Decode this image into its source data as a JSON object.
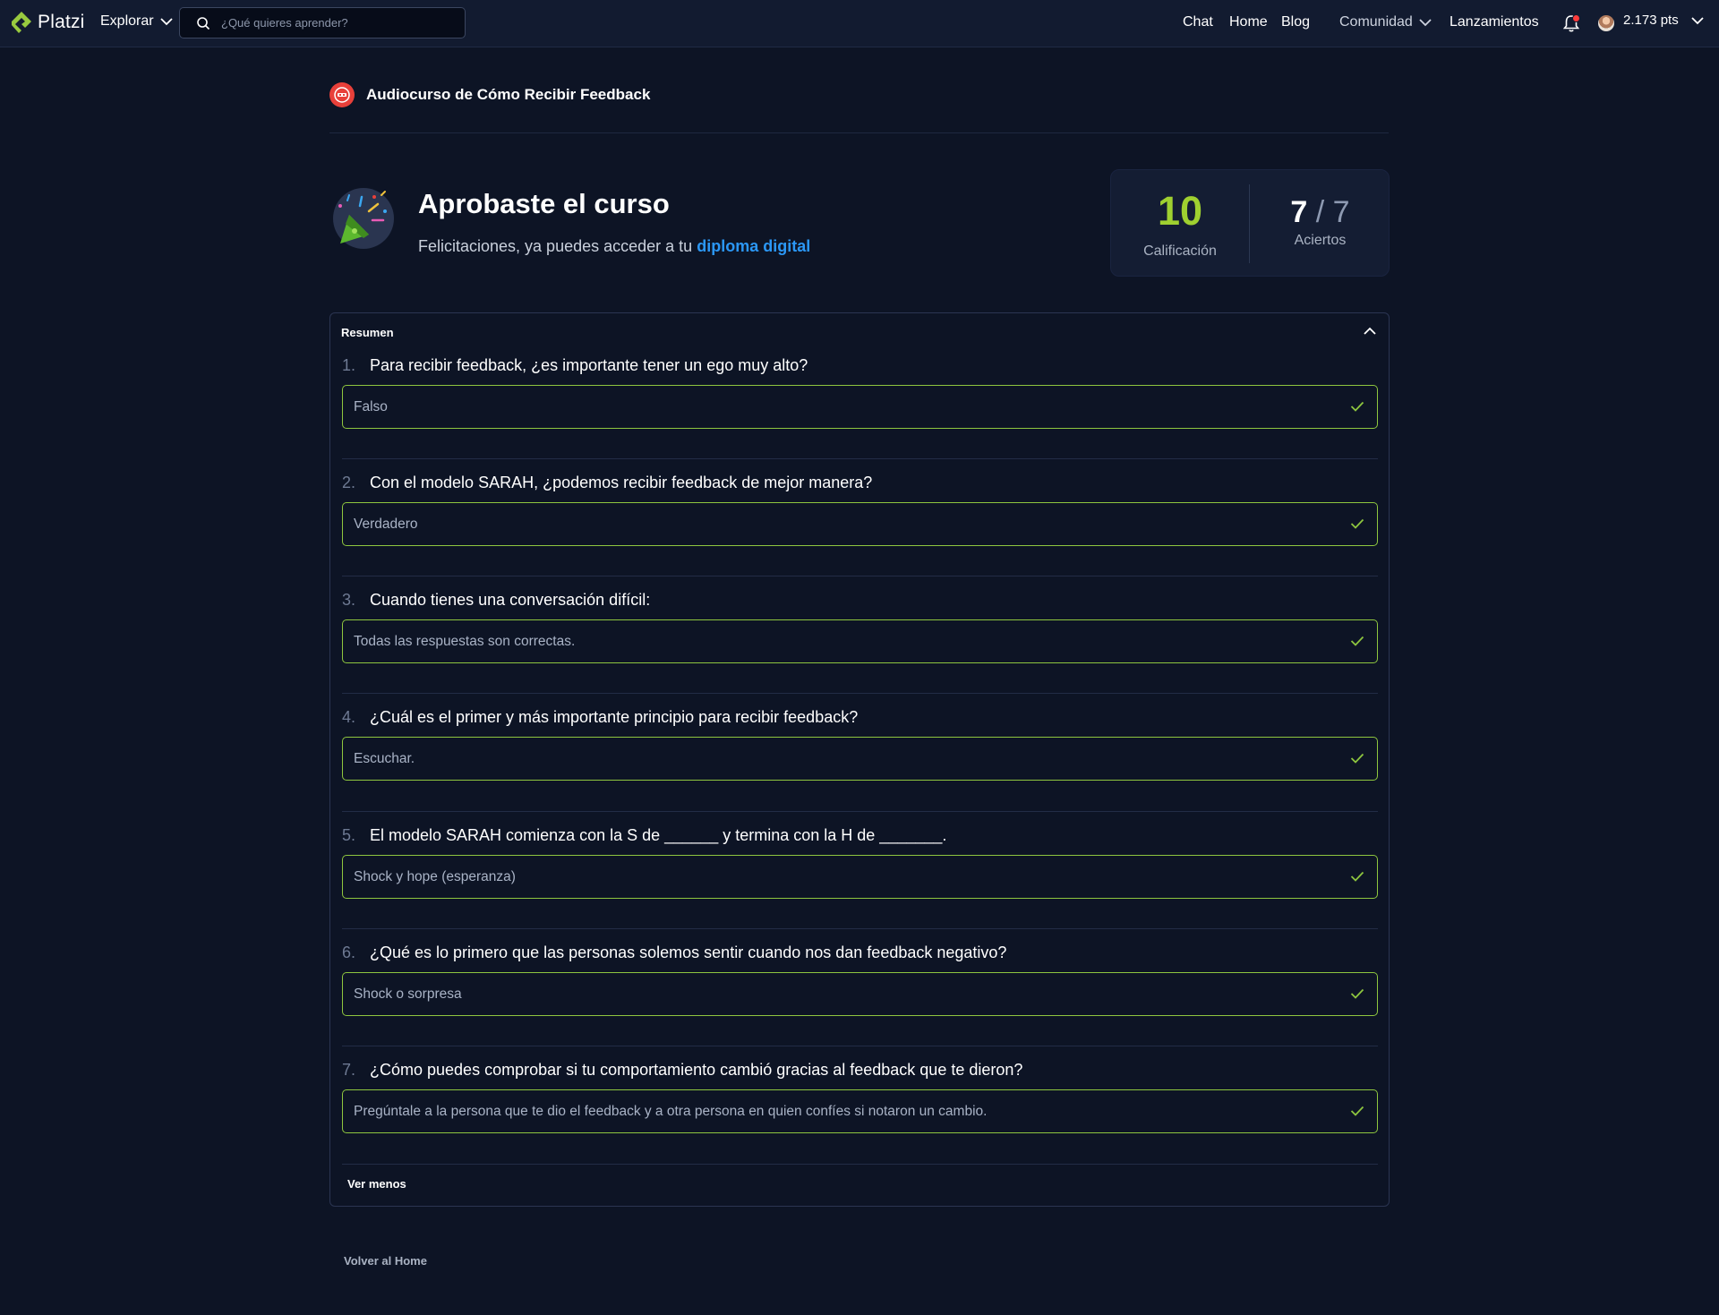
{
  "navbar": {
    "logo_text": "Platzi",
    "explore_label": "Explorar",
    "search_placeholder": "¿Qué quieres aprender?",
    "links": {
      "chat": "Chat",
      "home": "Home",
      "blog": "Blog",
      "community": "Comunidad",
      "launches": "Lanzamientos"
    },
    "points": "2.173 pts"
  },
  "course": {
    "title": "Audiocurso de Cómo Recibir Feedback"
  },
  "result": {
    "title": "Aprobaste el curso",
    "subtitle_prefix": "Felicitaciones, ya puedes acceder a tu",
    "diploma_link": "diploma digital",
    "grade": "10",
    "grade_label": "Calificación",
    "hits": "7",
    "hits_slash": "/",
    "hits_total": "7",
    "hits_label": "Aciertos"
  },
  "summary": {
    "label": "Resumen",
    "see_less": "Ver menos",
    "questions": [
      {
        "number": "1.",
        "text": "Para recibir feedback, ¿es importante tener un ego muy alto?",
        "answer": "Falso"
      },
      {
        "number": "2.",
        "text": "Con el modelo SARAH, ¿podemos recibir feedback de mejor manera?",
        "answer": "Verdadero"
      },
      {
        "number": "3.",
        "text": "Cuando tienes una conversación difícil:",
        "answer": "Todas las respuestas son correctas."
      },
      {
        "number": "4.",
        "text": "¿Cuál es el primer y más importante principio para recibir feedback?",
        "answer": "Escuchar."
      },
      {
        "number": "5.",
        "text": "El modelo SARAH comienza con la S de ______ y termina con la H de _______.",
        "answer": "Shock y hope (esperanza)"
      },
      {
        "number": "6.",
        "text": "¿Qué es lo primero que las personas solemos sentir cuando nos dan feedback negativo?",
        "answer": "Shock o sorpresa"
      },
      {
        "number": "7.",
        "text": "¿Cómo puedes comprobar si tu comportamiento cambió gracias al feedback que te dieron?",
        "answer": "Pregúntale a la persona que te dio el feedback y a otra persona en quien confíes si notaron un cambio."
      }
    ]
  },
  "footer": {
    "back_home": "Volver al Home"
  },
  "colors": {
    "background": "#0d1425",
    "navbar": "#121b30",
    "accent_green": "#9fd030",
    "link_blue": "#2b97f5",
    "answer_border": "#8ec63f"
  }
}
